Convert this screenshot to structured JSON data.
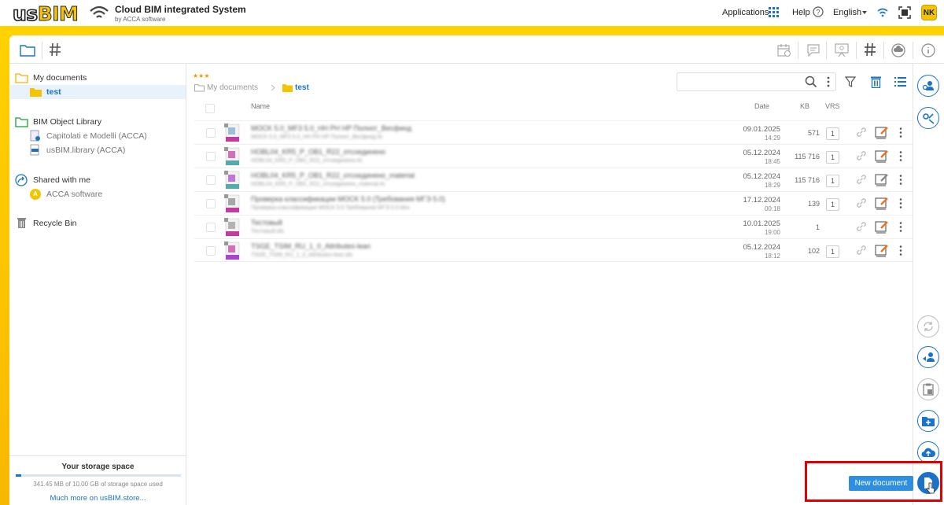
{
  "header": {
    "logo_us": "us",
    "logo_bim": "BIM",
    "title": "Cloud BIM integrated System",
    "subtitle": "by ACCA software",
    "applications": "Applications",
    "help": "Help",
    "language": "English",
    "user_initials": "NK"
  },
  "sidebar": {
    "my_documents": "My documents",
    "test": "test",
    "bim_object_library": "BIM Object Library",
    "capitolati": "Capitolati e Modelli (ACCA)",
    "usbim_library": "usBIM.library (ACCA)",
    "shared_with_me": "Shared with me",
    "acca_software": "ACCA software",
    "recycle_bin": "Recycle Bin"
  },
  "storage": {
    "title": "Your storage space",
    "used_text": "341.45 MB of 10.00 GB of storage space used",
    "used_fraction": 0.034,
    "more_link": "Much more on usBIM.store..."
  },
  "main": {
    "rating": "★★★",
    "breadcrumb_root": "My documents",
    "breadcrumb_current": "test",
    "columns": {
      "name": "Name",
      "date": "Date",
      "kb": "KB",
      "vrs": "VRS"
    },
    "rows": [
      {
        "name": "MOCK 5.0_MF3 5.0_HH PH HP Полнот_Весфинд",
        "sub": "MOCK 5.0_MF3 5.0_HH PH HP Полнот_Весфинд.ifc",
        "date": "09.01.2025",
        "time": "14:29",
        "kb": "571",
        "vrs": "1",
        "edit_color": "#f07020"
      },
      {
        "name": "HOBL04_KR5_P_OB1_R22_отсоединено",
        "sub": "HOBL04_KR5_P_OB1_R22_отсоединено.ifc",
        "date": "05.12.2024",
        "time": "18:45",
        "kb": "115 716",
        "vrs": "1",
        "edit_color": "#f07020"
      },
      {
        "name": "HOBL04_KR5_P_OB1_R22_отсоединено_material",
        "sub": "HOBL04_KR5_P_OB1_R22_отсоединено_material.ifc",
        "date": "05.12.2024",
        "time": "18:29",
        "kb": "115 716",
        "vrs": "1",
        "edit_color": "#888888"
      },
      {
        "name": "Проверка классификации MOCK 5.0 (Требования МГЭ 5.0)",
        "sub": "Проверка классификации MOCK 5.0 Требования МГЭ 5.0.idsx",
        "date": "17.12.2024",
        "time": "00:18",
        "kb": "139",
        "vrs": "1",
        "edit_color": "#f07020"
      },
      {
        "name": "Тестовый",
        "sub": "Тестовый.ids",
        "date": "10.01.2025",
        "time": "19:00",
        "kb": "1",
        "vrs": "",
        "edit_color": "#f07020"
      },
      {
        "name": "TSGE_TSIM_RU_1_0_Attributes-lean",
        "sub": "TSGE_TSIM_RU_1_0_Attributes-lean.ids",
        "date": "05.12.2024",
        "time": "18:12",
        "kb": "102",
        "vrs": "1",
        "edit_color": "#f07020"
      }
    ]
  },
  "new_document": "New document",
  "colors": {
    "accent": "#1a73c8",
    "brand_yellow": "#ffd200",
    "highlight": "#e00000"
  }
}
